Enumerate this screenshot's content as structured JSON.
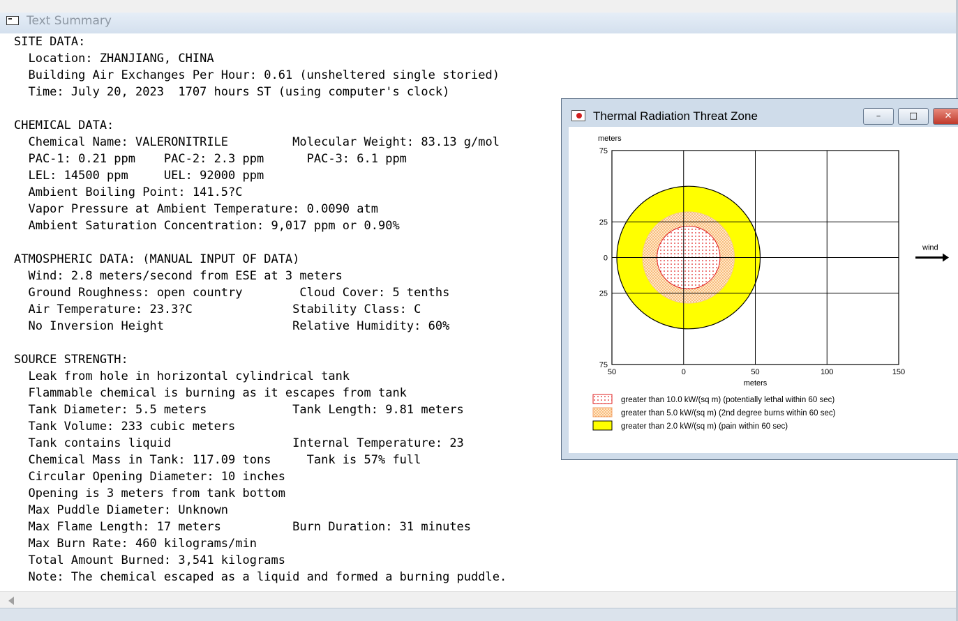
{
  "main_window": {
    "title": "Text Summary",
    "lines": [
      "SITE DATA:",
      "  Location: ZHANJIANG, CHINA",
      "  Building Air Exchanges Per Hour: 0.61 (unsheltered single storied)",
      "  Time: July 20, 2023  1707 hours ST (using computer's clock)",
      "",
      "CHEMICAL DATA:",
      "  Chemical Name: VALERONITRILE         Molecular Weight: 83.13 g/mol",
      "  PAC-1: 0.21 ppm    PAC-2: 2.3 ppm      PAC-3: 6.1 ppm",
      "  LEL: 14500 ppm     UEL: 92000 ppm",
      "  Ambient Boiling Point: 141.5?C",
      "  Vapor Pressure at Ambient Temperature: 0.0090 atm",
      "  Ambient Saturation Concentration: 9,017 ppm or 0.90%",
      "",
      "ATMOSPHERIC DATA: (MANUAL INPUT OF DATA)",
      "  Wind: 2.8 meters/second from ESE at 3 meters",
      "  Ground Roughness: open country        Cloud Cover: 5 tenths",
      "  Air Temperature: 23.3?C              Stability Class: C",
      "  No Inversion Height                  Relative Humidity: 60%",
      "",
      "SOURCE STRENGTH:",
      "  Leak from hole in horizontal cylindrical tank",
      "  Flammable chemical is burning as it escapes from tank",
      "  Tank Diameter: 5.5 meters            Tank Length: 9.81 meters",
      "  Tank Volume: 233 cubic meters",
      "  Tank contains liquid                 Internal Temperature: 23",
      "  Chemical Mass in Tank: 117.09 tons     Tank is 57% full",
      "  Circular Opening Diameter: 10 inches",
      "  Opening is 3 meters from tank bottom",
      "  Max Puddle Diameter: Unknown",
      "  Max Flame Length: 17 meters          Burn Duration: 31 minutes",
      "  Max Burn Rate: 460 kilograms/min",
      "  Total Amount Burned: 3,541 kilograms",
      "  Note: The chemical escaped as a liquid and formed a burning puddle."
    ]
  },
  "threat_window": {
    "title": "Thermal Radiation Threat Zone",
    "minimize_label": "–",
    "maximize_label": "□",
    "close_label": "✕",
    "icon": "threat-zone-icon"
  },
  "chart_data": {
    "type": "area",
    "y_unit_label": "meters",
    "x_unit_label": "meters",
    "x_ticks": [
      "50",
      "0",
      "50",
      "100",
      "150"
    ],
    "x_tick_values": [
      -50,
      0,
      50,
      100,
      150
    ],
    "y_ticks": [
      "75",
      "25",
      "0",
      "25",
      "75"
    ],
    "y_tick_values": [
      75,
      25,
      0,
      -25,
      -75
    ],
    "xlim": [
      -50,
      150
    ],
    "ylim": [
      -75,
      75
    ],
    "grid": true,
    "wind_label": "wind",
    "wind_direction": "right",
    "zones": [
      {
        "name": "red",
        "legend": "greater than 10.0 kW/(sq m) (potentially lethal within 60 sec)",
        "radius_m": 22,
        "color": "#ff0000",
        "fill": "dotted"
      },
      {
        "name": "orange",
        "legend": "greater than 5.0 kW/(sq m) (2nd degree burns within 60 sec)",
        "radius_m": 32,
        "color": "#ff9900",
        "fill": "stippled"
      },
      {
        "name": "yellow",
        "legend": "greater than 2.0 kW/(sq m) (pain within 60 sec)",
        "radius_m": 50,
        "color": "#ffff00",
        "fill": "solid"
      }
    ],
    "legend_position": "bottom"
  }
}
